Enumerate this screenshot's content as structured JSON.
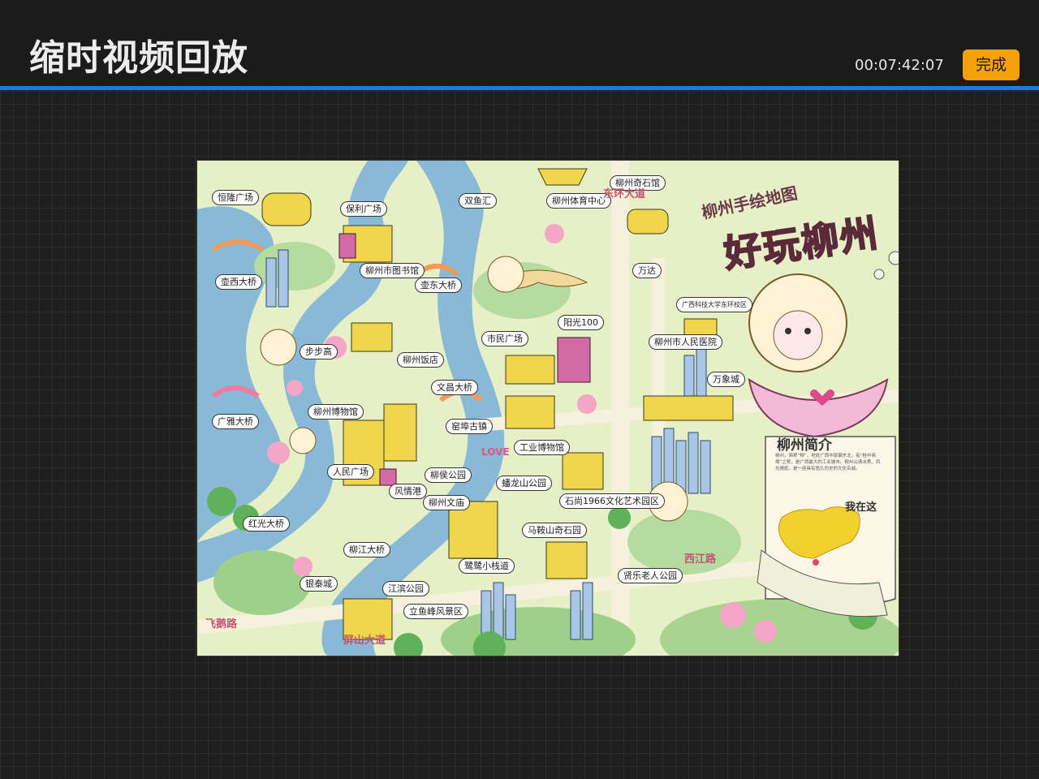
{
  "header": {
    "title": "缩时视频回放",
    "timecode": "00:07:42:07",
    "done_label": "完成"
  },
  "colors": {
    "accent_line": "#1a7ae8",
    "done_button": "#f5a20a",
    "background": "#1e1e1e"
  },
  "artwork": {
    "subtitle": "柳州手绘地图",
    "title": "好玩柳州",
    "intro_title": "柳州简介",
    "intro_text": "柳州，简称“柳”，地处广西中部偏东北，有“桂中商埠”之称，是广西最大的工业城市。柳州山清水秀，风光旖旎，是一座具有悠久历史的文化名城。",
    "here_label": "我在这",
    "love_text": "LOVE",
    "landmarks": [
      {
        "name": "窑埠古镇",
        "key": "yaobu"
      },
      {
        "name": "广雅大桥",
        "key": "guangya"
      },
      {
        "name": "步步高",
        "key": "bubugao"
      },
      {
        "name": "柳州饭店",
        "key": "fandian"
      },
      {
        "name": "柳州博物馆",
        "key": "bowuguan"
      },
      {
        "name": "人民广场",
        "key": "renmin"
      },
      {
        "name": "风情港",
        "key": "fengqing"
      },
      {
        "name": "柳侯公园",
        "key": "liuhou"
      },
      {
        "name": "柳州文庙",
        "key": "wenmiao"
      },
      {
        "name": "银泰城",
        "key": "yintai"
      },
      {
        "name": "江滨公园",
        "key": "jiangbin"
      },
      {
        "name": "立鱼峰风景区",
        "key": "liyu"
      },
      {
        "name": "鹭鹭小栈道",
        "key": "zhandao"
      },
      {
        "name": "市民广场",
        "key": "shimin"
      },
      {
        "name": "阳光100",
        "key": "yangguang"
      },
      {
        "name": "工业博物馆",
        "key": "gongye"
      },
      {
        "name": "蟠龙山公园",
        "key": "panlong"
      },
      {
        "name": "石尚1966文化艺术园区",
        "key": "shishang"
      },
      {
        "name": "马鞍山奇石园",
        "key": "maanshan"
      },
      {
        "name": "贤乐老人公园",
        "key": "xianle"
      },
      {
        "name": "万达",
        "key": "wanda"
      },
      {
        "name": "柳州市人民医院",
        "key": "yiyuan"
      },
      {
        "name": "万象城",
        "key": "wanxiang"
      },
      {
        "name": "双鱼汇",
        "key": "shuangyu"
      },
      {
        "name": "柳州体育中心",
        "key": "tiyu"
      },
      {
        "name": "柳州奇石馆",
        "key": "qishi"
      },
      {
        "name": "保利广场",
        "key": "baoli"
      },
      {
        "name": "柳州市图书馆",
        "key": "tushu"
      },
      {
        "name": "壶东大桥",
        "key": "hudong"
      },
      {
        "name": "壶西大桥",
        "key": "huxi"
      },
      {
        "name": "恒隆广场",
        "key": "henglong"
      },
      {
        "name": "文昌大桥",
        "key": "wenchang"
      },
      {
        "name": "红光大桥",
        "key": "hongguang"
      },
      {
        "name": "柳江大桥",
        "key": "liujiang"
      },
      {
        "name": "广西科技大学东环校区",
        "key": "keji"
      }
    ],
    "roads": [
      "东环大道",
      "飞鹅路",
      "屏山大道",
      "西江路"
    ]
  }
}
